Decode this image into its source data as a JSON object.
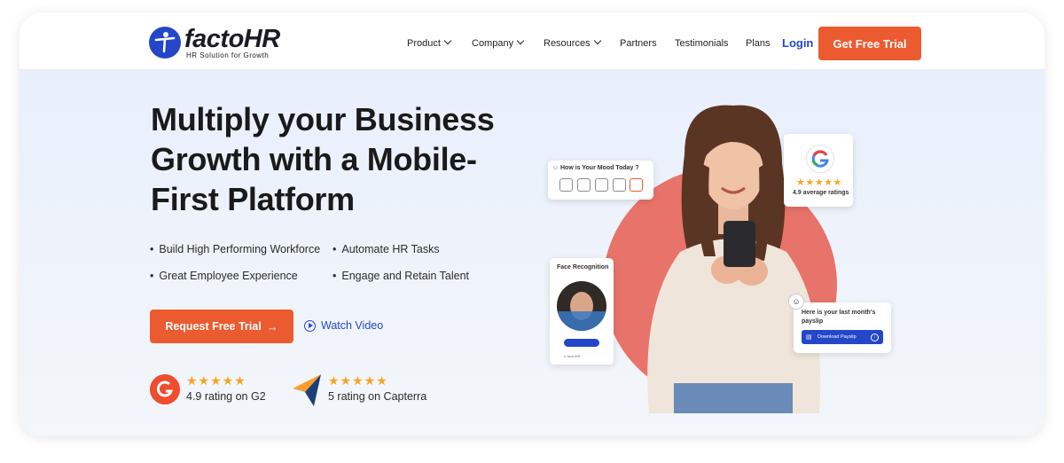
{
  "brand": {
    "name": "factoHR",
    "tagline": "HR Solution for Growth"
  },
  "nav": {
    "items": [
      {
        "label": "Product",
        "dropdown": true
      },
      {
        "label": "Company",
        "dropdown": true
      },
      {
        "label": "Resources",
        "dropdown": true
      },
      {
        "label": "Partners",
        "dropdown": false
      },
      {
        "label": "Testimonials",
        "dropdown": false
      },
      {
        "label": "Plans",
        "dropdown": false
      }
    ],
    "login_label": "Login",
    "cta_label": "Get Free Trial"
  },
  "hero": {
    "headline": "Multiply your Business Growth with a Mobile-First Platform",
    "features": [
      "Build High Performing Workforce",
      "Automate HR Tasks",
      "Great Employee Experience",
      "Engage and Retain Talent"
    ],
    "primary_button": "Request Free Trial",
    "secondary_button": "Watch Video"
  },
  "ratings": [
    {
      "source": "G2",
      "text": "4.9 rating on G2",
      "stars": 5
    },
    {
      "source": "Capterra",
      "text": "5 rating on Capterra",
      "stars": 5
    }
  ],
  "cards": {
    "mood": {
      "title": "How is Your Mood Today ?"
    },
    "google": {
      "rating_text": "4.9 average ratings",
      "stars": 5
    },
    "face": {
      "title": "Face Recognition"
    },
    "payslip": {
      "text": "Here is your last month's payslip",
      "button": "Download Payslip"
    }
  },
  "colors": {
    "accent": "#ec5a2f",
    "link": "#2446c9",
    "star": "#f5a623",
    "circle": "#e8736a"
  }
}
